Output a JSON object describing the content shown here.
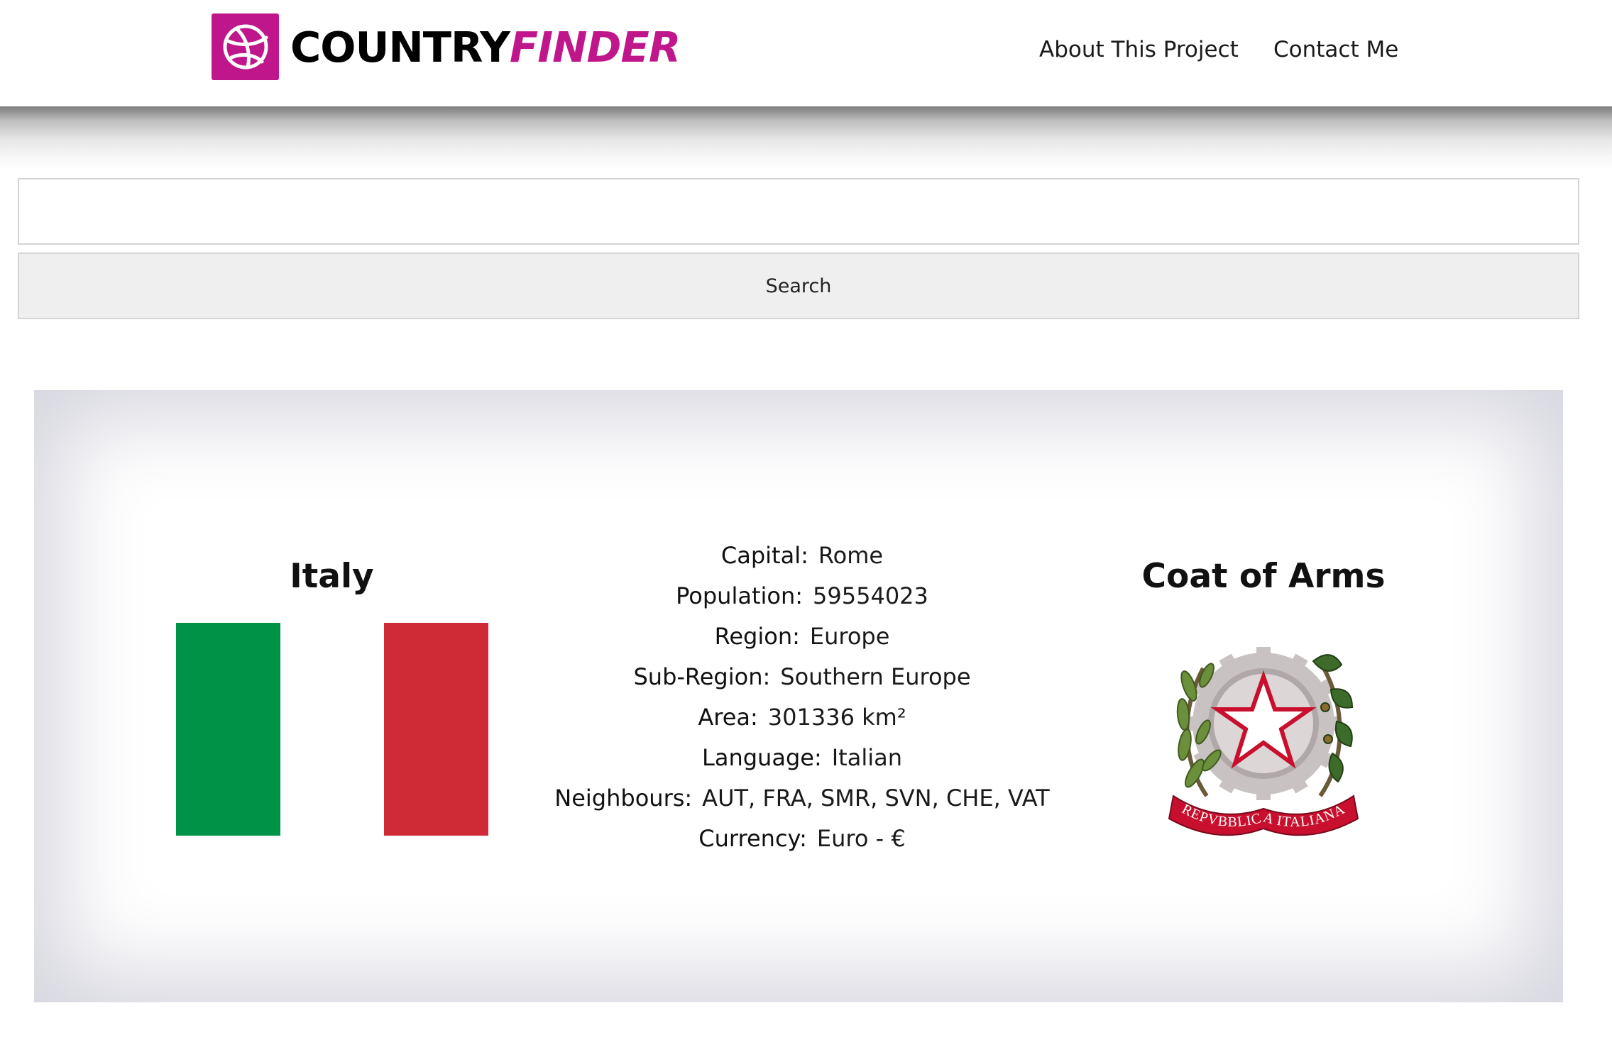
{
  "header": {
    "logo_word1": "COUNTRY",
    "logo_word2": "FINDER",
    "logo_icon": "basketball-icon",
    "nav": [
      "About This Project",
      "Contact Me"
    ]
  },
  "search": {
    "placeholder": "",
    "value": "",
    "button_label": "Search"
  },
  "country": {
    "name": "Italy",
    "flag_colors": [
      "#009246",
      "#ffffff",
      "#ce2b37"
    ],
    "facts": [
      {
        "label": "Capital:",
        "value": "Rome"
      },
      {
        "label": "Population:",
        "value": "59554023"
      },
      {
        "label": "Region:",
        "value": "Europe"
      },
      {
        "label": "Sub-Region:",
        "value": "Southern Europe"
      },
      {
        "label": "Area:",
        "value": "301336 km²"
      },
      {
        "label": "Language:",
        "value": "Italian"
      },
      {
        "label": "Neighbours:",
        "value": "AUT, FRA, SMR, SVN, CHE, VAT"
      },
      {
        "label": "Currency:",
        "value": "Euro - €"
      }
    ],
    "coat_title": "Coat of Arms",
    "coat_motto": "REPVBBLICA ITALIANA"
  },
  "colors": {
    "brand": "#c0168c"
  }
}
